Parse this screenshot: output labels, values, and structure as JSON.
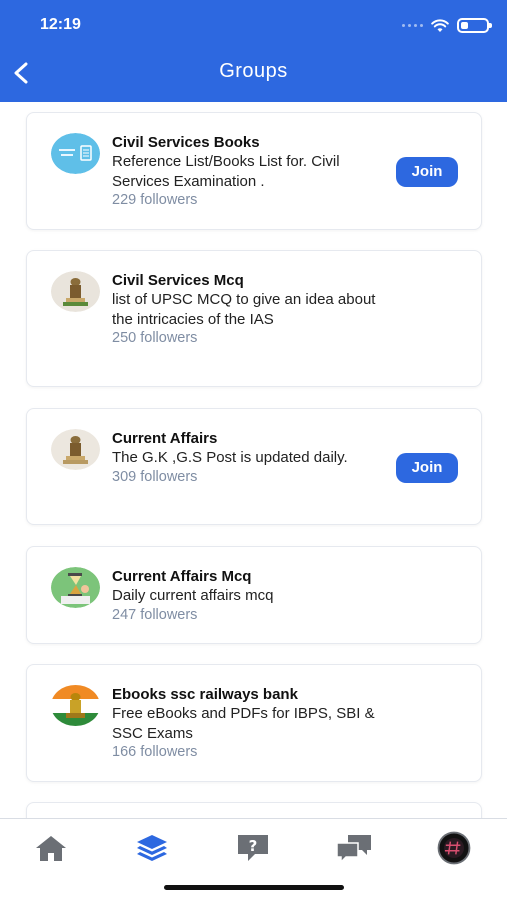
{
  "status_bar": {
    "time": "12:19",
    "battery_level": 0.3
  },
  "header": {
    "title": "Groups",
    "back_icon": "chevron-left-icon"
  },
  "groups": [
    {
      "name": "Civil Services Books",
      "description": "Reference List/Books List for. Civil Services Examination .",
      "followers": "229 followers",
      "join_label": "Join",
      "avatar": "books-logo-avatar"
    },
    {
      "name": "Civil Services Mcq",
      "description": "list of UPSC MCQ to give an idea about the intricacies of the IAS",
      "followers": "250 followers",
      "avatar": "emblem-avatar"
    },
    {
      "name": "Current Affairs",
      "description": "The G.K ,G.S Post is updated daily.",
      "followers": "309 followers",
      "join_label": "Join",
      "avatar": "emblem-avatar"
    },
    {
      "name": "Current Affairs Mcq",
      "description": "Daily current affairs mcq",
      "followers": "247 followers",
      "avatar": "study-avatar"
    },
    {
      "name": "Ebooks ssc railways bank",
      "description": "Free eBooks and PDFs for IBPS, SBI & SSC Exams",
      "followers": "166 followers",
      "avatar": "flag-emblem-avatar"
    }
  ],
  "tab_bar": {
    "items": [
      {
        "icon": "home-icon",
        "active": false
      },
      {
        "icon": "layers-icon",
        "active": true
      },
      {
        "icon": "question-icon",
        "active": false
      },
      {
        "icon": "chat-icon",
        "active": false
      },
      {
        "icon": "profile-avatar",
        "active": false
      }
    ],
    "active_color": "#2d68e0",
    "inactive_color": "#6b6f75"
  },
  "colors": {
    "primary": "#2d68e0",
    "followers_text": "#7f8da3"
  }
}
